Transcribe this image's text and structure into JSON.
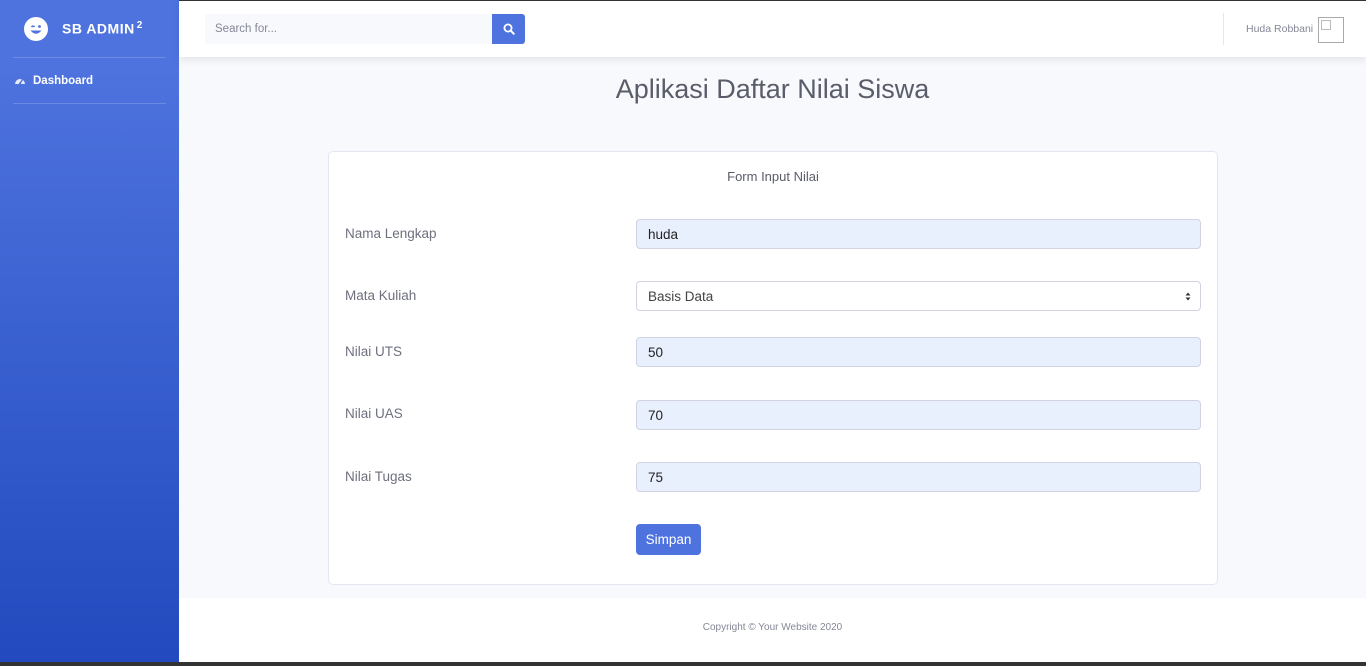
{
  "sidebar": {
    "brand": {
      "name": "SB ADMIN",
      "sup": "2"
    },
    "items": [
      {
        "label": "Dashboard",
        "icon": "tachometer-icon"
      }
    ]
  },
  "topbar": {
    "search": {
      "placeholder": "Search for...",
      "value": ""
    },
    "user_name": "Huda Robbani"
  },
  "page": {
    "title": "Aplikasi Daftar Nilai Siswa"
  },
  "form": {
    "title": "Form Input Nilai",
    "fields": [
      {
        "label": "Nama Lengkap",
        "value": "huda"
      },
      {
        "label": "Mata Kuliah",
        "value": "Basis Data"
      },
      {
        "label": "Nilai UTS",
        "value": "50"
      },
      {
        "label": "Nilai UAS",
        "value": "70"
      },
      {
        "label": "Nilai Tugas",
        "value": "75"
      }
    ],
    "submit_label": "Simpan"
  },
  "footer": {
    "copyright": "Copyright © Your Website 2020"
  },
  "colors": {
    "primary": "#4e73df",
    "sidebar_bottom": "#224abe",
    "autofill": "#e8f0fe"
  }
}
